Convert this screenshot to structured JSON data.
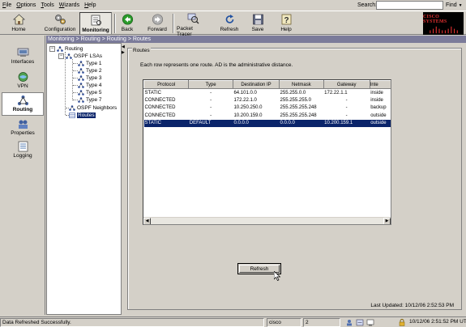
{
  "menu": {
    "items": [
      {
        "label": "File",
        "u": "F",
        "rest": "ile"
      },
      {
        "label": "Options",
        "u": "O",
        "rest": "ptions"
      },
      {
        "label": "Tools",
        "u": "T",
        "rest": "ools"
      },
      {
        "label": "Wizards",
        "u": "W",
        "rest": "izards"
      },
      {
        "label": "Help",
        "u": "H",
        "rest": "elp"
      }
    ],
    "search_label": "Search:",
    "search_value": "",
    "find_label": "Find"
  },
  "toolbar": {
    "home": "Home",
    "configuration": "Configuration",
    "monitoring": "Monitoring",
    "back": "Back",
    "forward": "Forward",
    "packet_tracer": "Packet Tracer",
    "refresh": "Refresh",
    "save": "Save",
    "help": "Help",
    "logo": "CISCO SYSTEMS"
  },
  "leftnav": {
    "interfaces": "Interfaces",
    "vpn": "VPN",
    "routing": "Routing",
    "properties": "Properties",
    "logging": "Logging"
  },
  "breadcrumb": "Monitoring > Routing > Routing > Routes",
  "tree": {
    "routing": "Routing",
    "ospf_lsas": "OSPF LSAs",
    "types": [
      "Type 1",
      "Type 2",
      "Type 3",
      "Type 4",
      "Type 5",
      "Type 7"
    ],
    "ospf_neighbors": "OSPF Neighbors",
    "routes": "Routes"
  },
  "routes_panel": {
    "title": "Routes",
    "description": "Each row represents one route. AD is the administrative distance.",
    "columns": [
      "Protocol",
      "Type",
      "Destination IP",
      "Netmask",
      "Gateway",
      "Inte"
    ],
    "rows": [
      [
        "STATIC",
        "-",
        "64.101.0.0",
        "255.255.0.0",
        "172.22.1.1",
        "inside"
      ],
      [
        "CONNECTED",
        "-",
        "172.22.1.0",
        "255.255.255.0",
        "-",
        "inside"
      ],
      [
        "CONNECTED",
        "-",
        "10.250.250.0",
        "255.255.255.248",
        "-",
        "backup"
      ],
      [
        "CONNECTED",
        "-",
        "10.200.159.0",
        "255.255.255.248",
        "-",
        "outside"
      ],
      [
        "STATIC",
        "DEFAULT",
        "0.0.0.0",
        "0.0.0.0",
        "10.200.159.1",
        "outside"
      ]
    ],
    "selected_row": 4,
    "refresh_button": "Refresh",
    "last_updated": "Last Updated: 10/12/06 2:52:53 PM"
  },
  "statusbar": {
    "message": "Data Refreshed Successfully.",
    "user": "cisco",
    "privilege": "2",
    "datetime": "10/12/06 2:51:52 PM UTC"
  },
  "colors": {
    "selection": "#0a246a",
    "breadcrumb_bg": "#7b7b9a",
    "window_bg": "#d4d0c8"
  }
}
